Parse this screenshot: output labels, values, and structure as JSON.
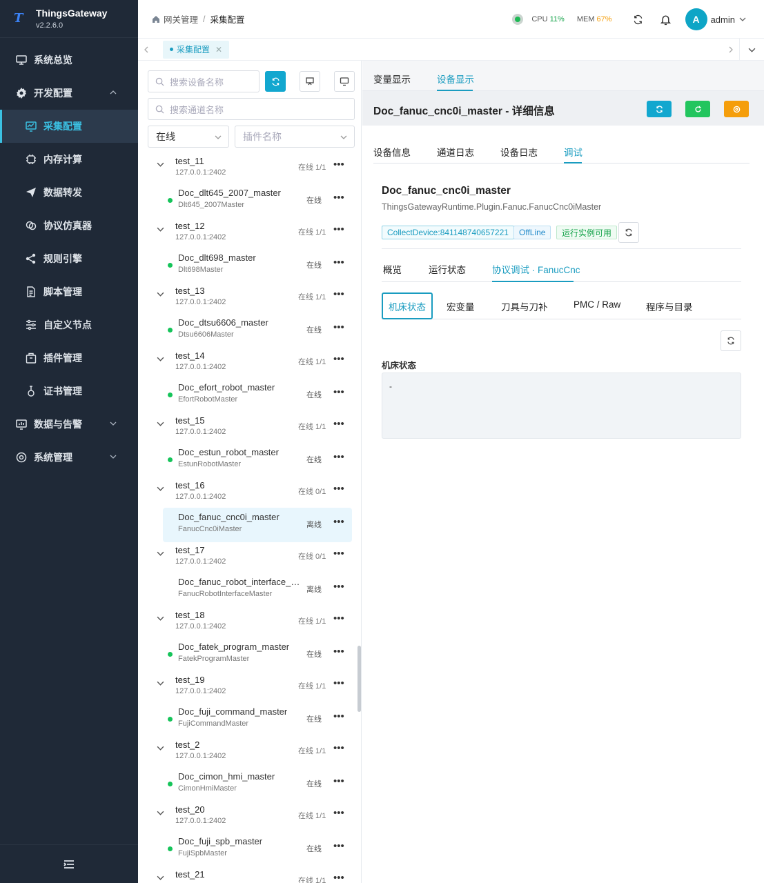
{
  "brand": {
    "title": "ThingsGateway",
    "version": "v2.2.6.0",
    "logo_letter": "T"
  },
  "sidebar": {
    "items": [
      {
        "label": "系统总览",
        "icon": "monitor-icon"
      },
      {
        "label": "开发配置",
        "icon": "gear-icon",
        "expanded": true
      },
      {
        "label": "采集配置",
        "icon": "chart-monitor-icon",
        "active": true
      },
      {
        "label": "内存计算",
        "icon": "chip-icon"
      },
      {
        "label": "数据转发",
        "icon": "send-icon"
      },
      {
        "label": "协议仿真器",
        "icon": "link-icon"
      },
      {
        "label": "规则引擎",
        "icon": "share-icon"
      },
      {
        "label": "脚本管理",
        "icon": "document-icon"
      },
      {
        "label": "自定义节点",
        "icon": "sliders-icon"
      },
      {
        "label": "插件管理",
        "icon": "package-icon"
      },
      {
        "label": "证书管理",
        "icon": "certificate-icon"
      },
      {
        "label": "数据与告警",
        "icon": "chart-icon"
      },
      {
        "label": "系统管理",
        "icon": "settings-icon"
      }
    ]
  },
  "header": {
    "breadcrumb": [
      "网关管理",
      "采集配置"
    ],
    "cpu_label": "CPU",
    "cpu_value": "11%",
    "mem_label": "MEM",
    "mem_value": "67%",
    "user_initial": "A",
    "user_name": "admin"
  },
  "tabbar": {
    "tabs": [
      {
        "label": "采集配置",
        "active": true
      }
    ]
  },
  "devpanel": {
    "search_device_placeholder": "搜索设备名称",
    "search_channel_placeholder": "搜索通道名称",
    "status_filter": "在线",
    "plugin_filter_placeholder": "插件名称",
    "channels": [
      {
        "name": "test_11",
        "ip": "127.0.0.1:2402",
        "status": "在线 1/1",
        "device": {
          "name": "Doc_dlt645_2007_master",
          "plugin": "Dlt645_2007Master",
          "status": "在线",
          "online": true
        }
      },
      {
        "name": "test_12",
        "ip": "127.0.0.1:2402",
        "status": "在线 1/1",
        "device": {
          "name": "Doc_dlt698_master",
          "plugin": "Dlt698Master",
          "status": "在线",
          "online": true
        }
      },
      {
        "name": "test_13",
        "ip": "127.0.0.1:2402",
        "status": "在线 1/1",
        "device": {
          "name": "Doc_dtsu6606_master",
          "plugin": "Dtsu6606Master",
          "status": "在线",
          "online": true
        }
      },
      {
        "name": "test_14",
        "ip": "127.0.0.1:2402",
        "status": "在线 1/1",
        "device": {
          "name": "Doc_efort_robot_master",
          "plugin": "EfortRobotMaster",
          "status": "在线",
          "online": true
        }
      },
      {
        "name": "test_15",
        "ip": "127.0.0.1:2402",
        "status": "在线 1/1",
        "device": {
          "name": "Doc_estun_robot_master",
          "plugin": "EstunRobotMaster",
          "status": "在线",
          "online": true
        }
      },
      {
        "name": "test_16",
        "ip": "127.0.0.1:2402",
        "status": "在线 0/1",
        "device": {
          "name": "Doc_fanuc_cnc0i_master",
          "plugin": "FanucCnc0iMaster",
          "status": "离线",
          "online": false,
          "selected": true
        }
      },
      {
        "name": "test_17",
        "ip": "127.0.0.1:2402",
        "status": "在线 0/1",
        "device": {
          "name": "Doc_fanuc_robot_interface_m...",
          "plugin": "FanucRobotInterfaceMaster",
          "status": "离线",
          "online": false
        }
      },
      {
        "name": "test_18",
        "ip": "127.0.0.1:2402",
        "status": "在线 1/1",
        "device": {
          "name": "Doc_fatek_program_master",
          "plugin": "FatekProgramMaster",
          "status": "在线",
          "online": true
        }
      },
      {
        "name": "test_19",
        "ip": "127.0.0.1:2402",
        "status": "在线 1/1",
        "device": {
          "name": "Doc_fuji_command_master",
          "plugin": "FujiCommandMaster",
          "status": "在线",
          "online": true
        }
      },
      {
        "name": "test_2",
        "ip": "127.0.0.1:2402",
        "status": "在线 1/1",
        "device": {
          "name": "Doc_cimon_hmi_master",
          "plugin": "CimonHmiMaster",
          "status": "在线",
          "online": true
        }
      },
      {
        "name": "test_20",
        "ip": "127.0.0.1:2402",
        "status": "在线 1/1",
        "device": {
          "name": "Doc_fuji_spb_master",
          "plugin": "FujiSpbMaster",
          "status": "在线",
          "online": true
        }
      },
      {
        "name": "test_21",
        "ip": "",
        "status": "在线 1/1",
        "device": null
      }
    ]
  },
  "detail": {
    "view_tabs": [
      "变量显示",
      "设备显示"
    ],
    "title": "Doc_fanuc_cnc0i_master - 详细信息",
    "info_tabs": [
      "设备信息",
      "通道日志",
      "设备日志",
      "调试"
    ],
    "device_name": "Doc_fanuc_cnc0i_master",
    "plugin_full": "ThingsGatewayRuntime.Plugin.Fanuc.FanucCnc0iMaster",
    "badges": [
      "CollectDevice:841148740657221",
      "OffLine",
      "运行实例可用"
    ],
    "debug_tabs": [
      "概览",
      "运行状态",
      "协议调试 · FanucCnc"
    ],
    "sub_tabs": [
      "机床状态",
      "宏变量",
      "刀具与刀补",
      "PMC / Raw",
      "程序与目录"
    ],
    "section_label": "机床状态",
    "section_value": "-"
  },
  "colors": {
    "accent": "#1a9cc0",
    "sidebar_bg": "#1f2937",
    "online": "#16c45a",
    "btn_blue": "#12a7cf",
    "btn_green": "#22c55e",
    "btn_orange": "#f59e0b"
  }
}
